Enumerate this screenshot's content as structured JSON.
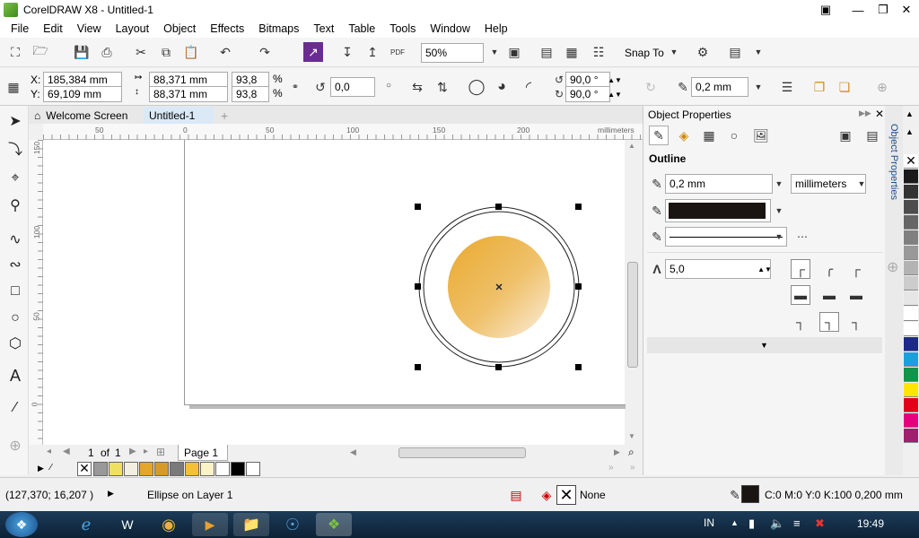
{
  "window": {
    "title": "CorelDRAW X8 - Untitled-1"
  },
  "menu": [
    "File",
    "Edit",
    "View",
    "Layout",
    "Object",
    "Effects",
    "Bitmaps",
    "Text",
    "Table",
    "Tools",
    "Window",
    "Help"
  ],
  "toolbar": {
    "zoom": "50%",
    "snap_to": "Snap To"
  },
  "property_bar": {
    "x_label": "X:",
    "x_value": "185,384 mm",
    "y_label": "Y:",
    "y_value": "69,109 mm",
    "width": "88,371 mm",
    "height": "88,371 mm",
    "scale_w": "93,8",
    "scale_h": "93,8",
    "pct": "%",
    "rotation": "0,0",
    "angle_start": "90,0 °",
    "angle_end": "90,0 °",
    "outline_width": "0,2 mm"
  },
  "tabs": {
    "welcome": "Welcome Screen",
    "doc": "Untitled-1"
  },
  "ruler": {
    "h_labels": [
      "50",
      "0",
      "50",
      "100",
      "150",
      "200",
      "millimeters"
    ],
    "v_labels": [
      "150",
      "100",
      "50",
      "0"
    ]
  },
  "page_nav": {
    "current": "1",
    "of": "of",
    "total": "1",
    "page_tab": "Page 1"
  },
  "object_properties": {
    "title": "Object Properties",
    "side_tab": "Object Properties",
    "section": "Outline",
    "width": "0,2 mm",
    "units": "millimeters",
    "miter": "5,0"
  },
  "status": {
    "coords": "(127,370; 16,207 )",
    "object": "Ellipse on Layer 1",
    "fill": "None",
    "outline_info": "C:0 M:0 Y:0 K:100  0,200 mm"
  },
  "taskbar": {
    "lang": "IN",
    "time": "19:49"
  },
  "colors": {
    "accent": "#1c6fb5",
    "palette_docs": [
      "#ffffff",
      "#999999",
      "#f0e060",
      "#f2efe0",
      "#e4a62a",
      "#d79a28",
      "#7a7a7a",
      "#f7bf38",
      "#fbf2c8",
      "#ffffff",
      "#000000",
      "#ffffff"
    ],
    "strip": [
      "#ffffff",
      "#1a1a1a",
      "#333333",
      "#4d4d4d",
      "#666666",
      "#808080",
      "#999999",
      "#b3b3b3",
      "#cccccc",
      "#e6e6e6",
      "#ffffff",
      "#1d2a8a",
      "#1ba0dc",
      "#12944a",
      "#ffe600",
      "#e2001a",
      "#e6007e",
      "#f0f0f0"
    ]
  }
}
